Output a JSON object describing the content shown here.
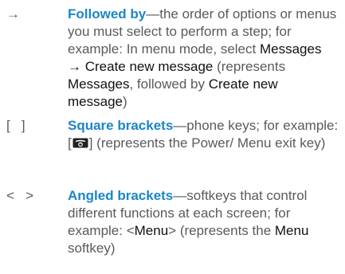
{
  "colors": {
    "term": "#1a86c8",
    "body_text": "#5a5a5a",
    "ui_text": "#111111"
  },
  "entries": [
    {
      "symbol": "→",
      "term": "Followed by",
      "dash": "—",
      "text1": "the order of options or menus you must select to perform a step; for example: In menu mode, select ",
      "ui1": "Messages",
      "arrow": " → ",
      "ui2": "Create new message",
      "text2": " (represents ",
      "ui3": "Messages",
      "text3": ", followed by ",
      "ui4": "Create new message",
      "text4": ")"
    },
    {
      "symbol": "[   ]",
      "term": "Square brackets",
      "dash": "—",
      "text1": "phone keys; for example: [",
      "icon": "power-menu-exit-key-icon",
      "text2": "] (represents the Power/ Menu exit key)"
    },
    {
      "symbol": "<   >",
      "term": "Angled brackets",
      "dash": "—",
      "text1": "softkeys that control different functions at each screen; for example: <",
      "ui1": "Menu",
      "text2": "> (represents the ",
      "ui2": "Menu",
      "text3": " softkey)"
    }
  ]
}
